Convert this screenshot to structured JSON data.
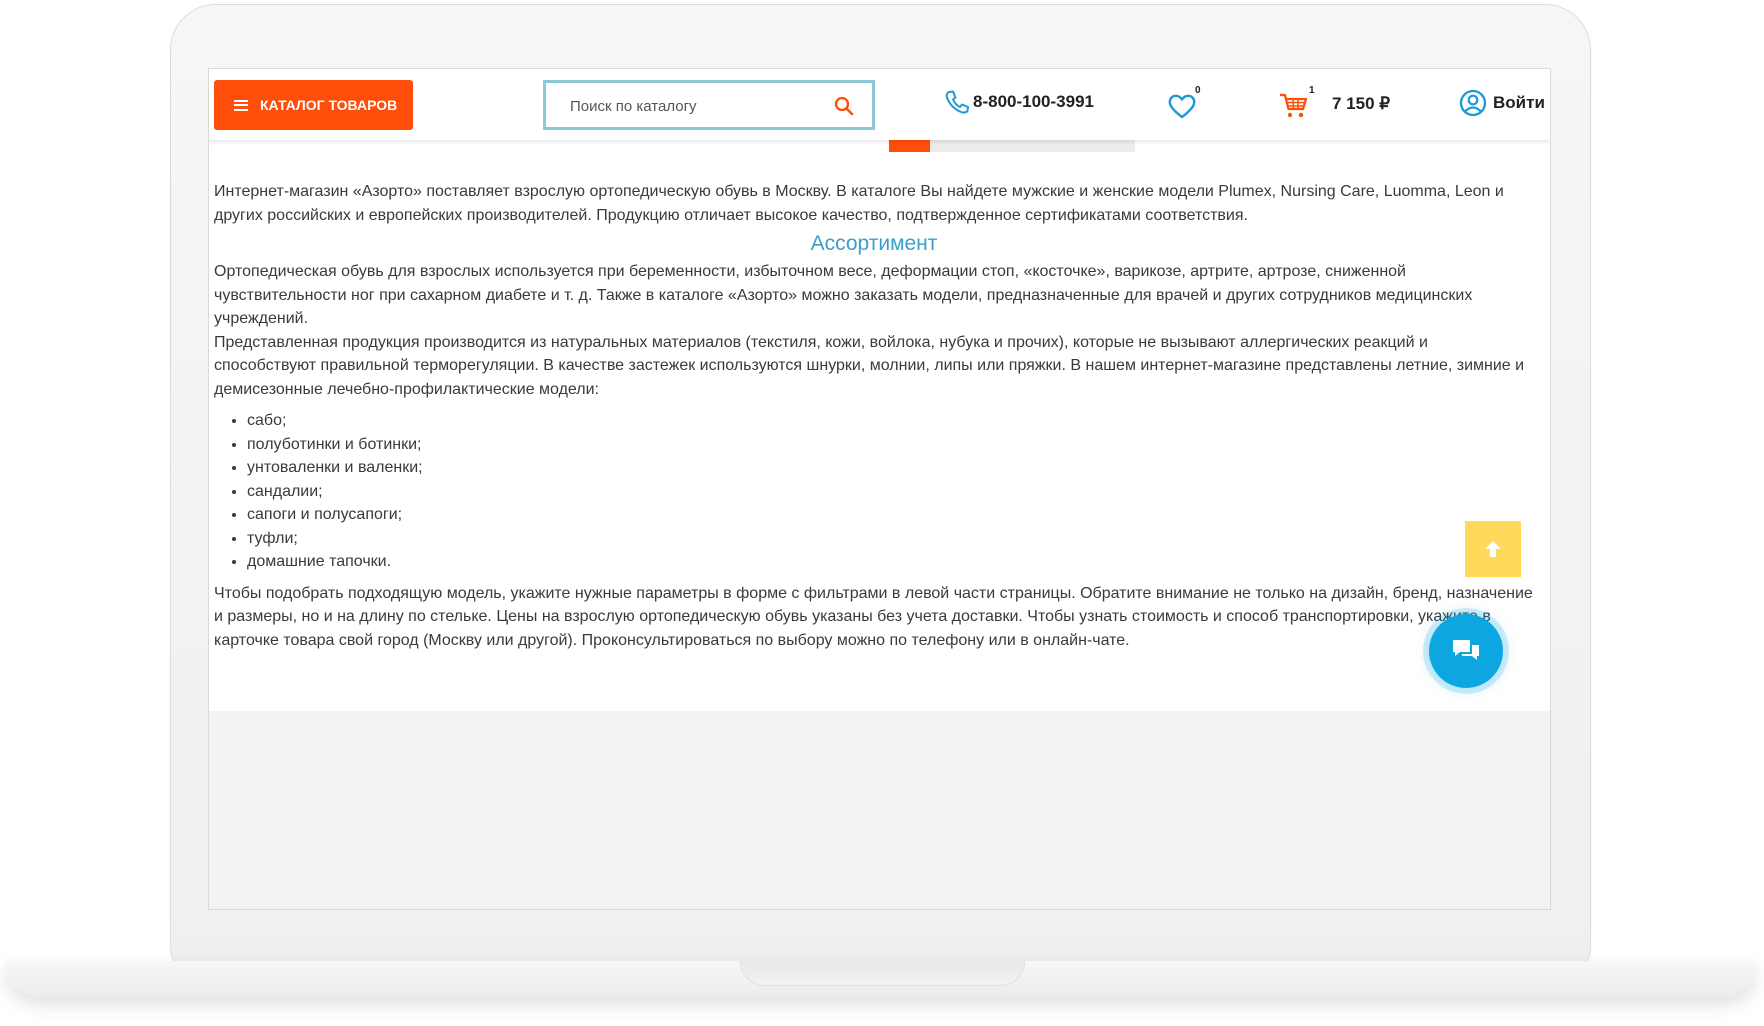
{
  "header": {
    "catalog_label": "КАТАЛОГ ТОВАРОВ",
    "search_placeholder": "Поиск по каталогу",
    "phone": "8-800-100-3991",
    "favorites_count": "0",
    "cart_count": "1",
    "cart_total": "7 150 ₽",
    "login_label": "Войти"
  },
  "colors": {
    "accent": "#ff4e0a",
    "link_title": "#3ba0c8",
    "search_border": "#8ec8d6",
    "scroll_top": "#ffd95a",
    "chat": "#0da6e0"
  },
  "content": {
    "intro": "Интернет-магазин «Азорто» поставляет взрослую ортопедическую обувь в Москву. В каталоге Вы найдете мужские и женские модели Plumex, Nursing Care, Luomma, Leon и других российских и европейских производителей. Продукцию отличает высокое качество, подтвержденное сертификатами соответствия.",
    "section_title": "Ассортимент",
    "para1": "Ортопедическая обувь для взрослых используется при беременности, избыточном весе, деформации стоп, «косточке», варикозе, артрите, артрозе, сниженной чувствительности ног при сахарном диабете и т. д. Также в каталоге «Азорто» можно заказать модели, предназначенные для врачей и других сотрудников медицинских учреждений.",
    "para2": "Представленная продукция производится из натуральных материалов (текстиля, кожи, войлока, нубука и прочих), которые не вызывают аллергических реакций и способствуют правильной терморегуляции. В качестве застежек используются шнурки, молнии, липы или пряжки. В нашем интернет-магазине представлены летние, зимние и демисезонные лечебно-профилактические модели:",
    "items": [
      "сабо;",
      "полуботинки и ботинки;",
      "унтоваленки и валенки;",
      "сандалии;",
      "сапоги и полусапоги;",
      "туфли;",
      "домашние тапочки."
    ],
    "para3": "Чтобы подобрать подходящую модель, укажите нужные параметры в форме с фильтрами в левой части страницы. Обратите внимание не только на дизайн, бренд, назначение и размеры, но и на длину по стельке. Цены на взрослую ортопедическую обувь указаны без учета доставки. Чтобы узнать стоимость и способ транспортировки, укажите в карточке товара свой город (Москву или другой). Проконсультироваться по выбору можно по телефону или в онлайн-чате."
  },
  "icons": {
    "search": "search-icon",
    "phone": "phone-icon",
    "favorites": "heart-icon",
    "cart": "cart-icon",
    "user": "user-circle-icon",
    "scroll_top": "arrow-up-icon",
    "chat": "chat-icon",
    "menu": "menu-icon"
  }
}
